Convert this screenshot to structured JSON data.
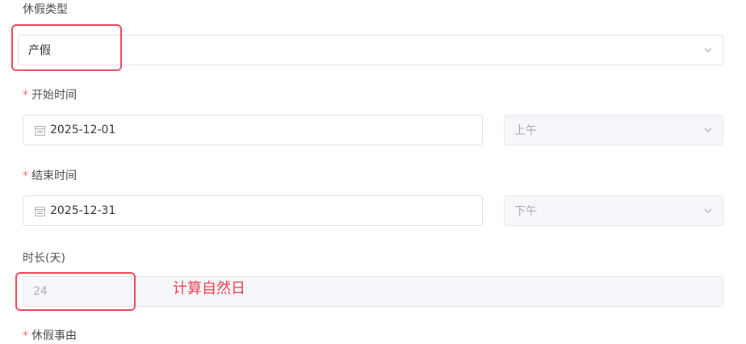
{
  "leave_type": {
    "label": "休假类型",
    "value": "产假"
  },
  "start": {
    "required_mark": "*",
    "label": "开始时间",
    "date": "2025-12-01",
    "half_day": "上午"
  },
  "end": {
    "required_mark": "*",
    "label": "结束时间",
    "date": "2025-12-31",
    "half_day": "下午"
  },
  "duration": {
    "label": "时长(天)",
    "value": "24",
    "annotation": "计算自然日"
  },
  "reason": {
    "required_mark": "*",
    "label": "休假事由"
  },
  "icons": {
    "calendar": "calendar-icon",
    "dropdown": "chevron-down-icon"
  },
  "colors": {
    "required": "#f56c6c",
    "highlight": "#ee4b5f",
    "annotation": "#e83f4f"
  }
}
